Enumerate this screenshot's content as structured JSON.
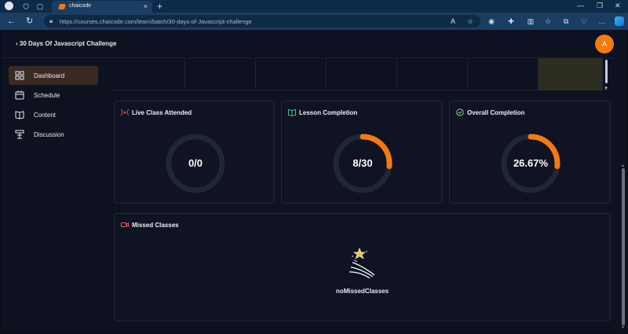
{
  "browser": {
    "tab_title": "chaicode",
    "url": "https://courses.chaicode.com/learn/batch/30-days-of-Javascript-challenge",
    "accent": "#1b3d62"
  },
  "header": {
    "back_label": "‹ 30 Days Of Javascript Challenge",
    "avatar_initial": "A",
    "avatar_color": "#f47a0e"
  },
  "sidebar": {
    "items": [
      {
        "label": "Dashboard",
        "icon": "dashboard-icon",
        "active": true
      },
      {
        "label": "Schedule",
        "icon": "calendar-icon",
        "active": false
      },
      {
        "label": "Content",
        "icon": "book-icon",
        "active": false
      },
      {
        "label": "Discussion",
        "icon": "discussion-icon",
        "active": false
      }
    ]
  },
  "stats": {
    "live": {
      "title": "Live Class Attended",
      "value": "0/0",
      "progress": 0,
      "icon": "broadcast-icon"
    },
    "lesson": {
      "title": "Lesson Completion",
      "value": "8/30",
      "progress": 0.2667,
      "icon": "book-open-icon"
    },
    "overall": {
      "title": "Overall Completion",
      "value": "26.67%",
      "progress": 0.2667,
      "icon": "check-circle-icon"
    }
  },
  "missed": {
    "title": "Missed Classes",
    "empty_text": "noMissedClasses",
    "icon": "video-icon"
  },
  "colors": {
    "progress": "#f47a0e",
    "ring_track": "#1f2638",
    "active_bg": "#3a2a24"
  }
}
